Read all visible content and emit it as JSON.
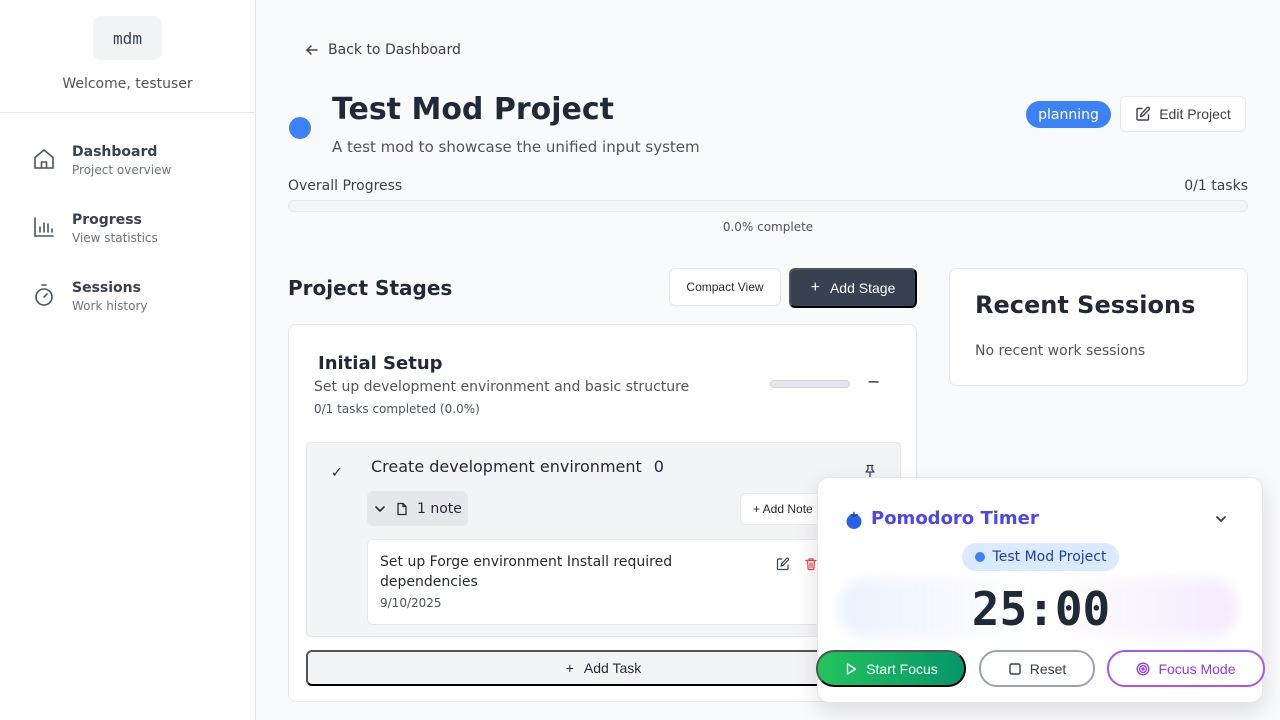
{
  "sidebar": {
    "logo": "mdm",
    "welcome": "Welcome, testuser",
    "items": [
      {
        "title": "Dashboard",
        "subtitle": "Project overview",
        "icon": "home-icon"
      },
      {
        "title": "Progress",
        "subtitle": "View statistics",
        "icon": "bar-chart-icon"
      },
      {
        "title": "Sessions",
        "subtitle": "Work history",
        "icon": "timer-icon"
      }
    ]
  },
  "header": {
    "back_label": "Back to Dashboard",
    "project_title": "Test Mod Project",
    "project_description": "A test mod to showcase the unified input system",
    "status": "planning",
    "edit_label": "Edit Project",
    "project_color": "#3b82f6"
  },
  "progress": {
    "label": "Overall Progress",
    "count": "0/1 tasks",
    "percent_text": "0.0% complete",
    "value": 0
  },
  "stages": {
    "title": "Project Stages",
    "compact_label": "Compact View",
    "add_stage_label": "Add Stage",
    "items": [
      {
        "name": "Initial Setup",
        "description": "Set up development environment and basic structure",
        "stats": "0/1 tasks completed (0.0%)",
        "collapse_symbol": "−",
        "progress_value": 0,
        "tasks": [
          {
            "check_symbol": "✓",
            "name": "Create development environment",
            "count": "0",
            "notes_label": "1 note",
            "add_note_label": "+ Add Note",
            "notes": [
              {
                "text": "Set up Forge environment Install required dependencies",
                "date": "9/10/2025"
              }
            ]
          }
        ],
        "add_task_label": "Add Task"
      }
    ]
  },
  "sessions": {
    "title": "Recent Sessions",
    "empty_text": "No recent work sessions"
  },
  "pomodoro": {
    "title": "Pomodoro Timer",
    "project": "Test Mod Project",
    "time": "25:00",
    "start_label": "Start Focus",
    "reset_label": "Reset",
    "focus_label": "Focus Mode"
  },
  "colors": {
    "accent": "#3b82f6",
    "primary_dark": "#374151",
    "pomodoro_title": "#4f46e5",
    "start_green": "#22c55e",
    "focus_purple": "#a855f7",
    "delete_red": "#ef4444"
  }
}
